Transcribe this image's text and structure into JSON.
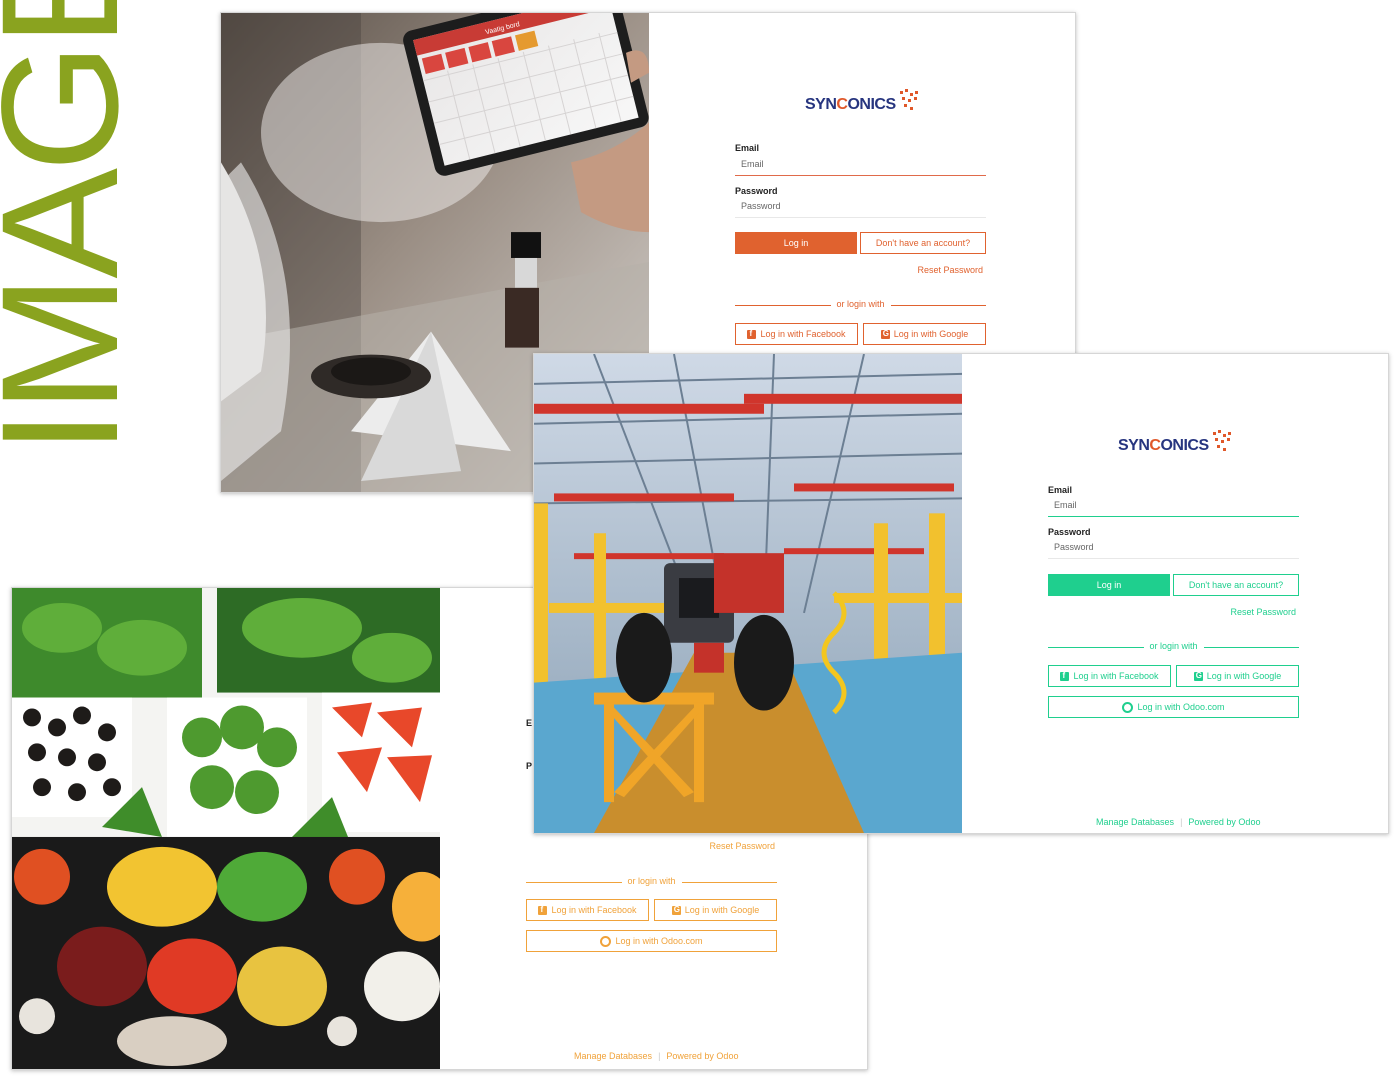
{
  "heading": {
    "text": "IMAGE",
    "color": "#8aa31f"
  },
  "brand": {
    "part1": "SYN",
    "part2": "C",
    "part3": "ONICS",
    "navy": "#27357f",
    "orange": "#e0582a"
  },
  "screens": {
    "restaurant": {
      "accent": "#e0622f",
      "tablet_title": "Vaatig bord",
      "email_label": "Email",
      "email_placeholder": "Email",
      "password_label": "Password",
      "password_placeholder": "Password",
      "login_label": "Log in",
      "signup_label": "Don't have an account?",
      "reset_label": "Reset Password",
      "or_login_with": "or login with",
      "facebook_label": "Log in with Facebook",
      "google_label": "Log in with Google"
    },
    "groceries": {
      "accent": "#f0a23a",
      "email_label_partial": "E",
      "password_label_partial": "P",
      "reset_label": "Reset Password",
      "or_login_with": "or login with",
      "facebook_label": "Log in with Facebook",
      "google_label": "Log in with Google",
      "odoo_label": "Log in with Odoo.com",
      "manage_label": "Manage Databases",
      "powered_label": "Powered by Odoo"
    },
    "factory": {
      "accent": "#1fcf8e",
      "email_label": "Email",
      "email_placeholder": "Email",
      "password_label": "Password",
      "password_placeholder": "Password",
      "login_label": "Log in",
      "signup_label": "Don't have an account?",
      "reset_label": "Reset Password",
      "or_login_with": "or login with",
      "facebook_label": "Log in with Facebook",
      "google_label": "Log in with Google",
      "odoo_label": "Log in with Odoo.com",
      "manage_label": "Manage Databases",
      "powered_label": "Powered by Odoo"
    }
  },
  "icons": {
    "facebook": "facebook-icon",
    "google": "google-plus-icon",
    "odoo": "odoo-ring-icon"
  }
}
